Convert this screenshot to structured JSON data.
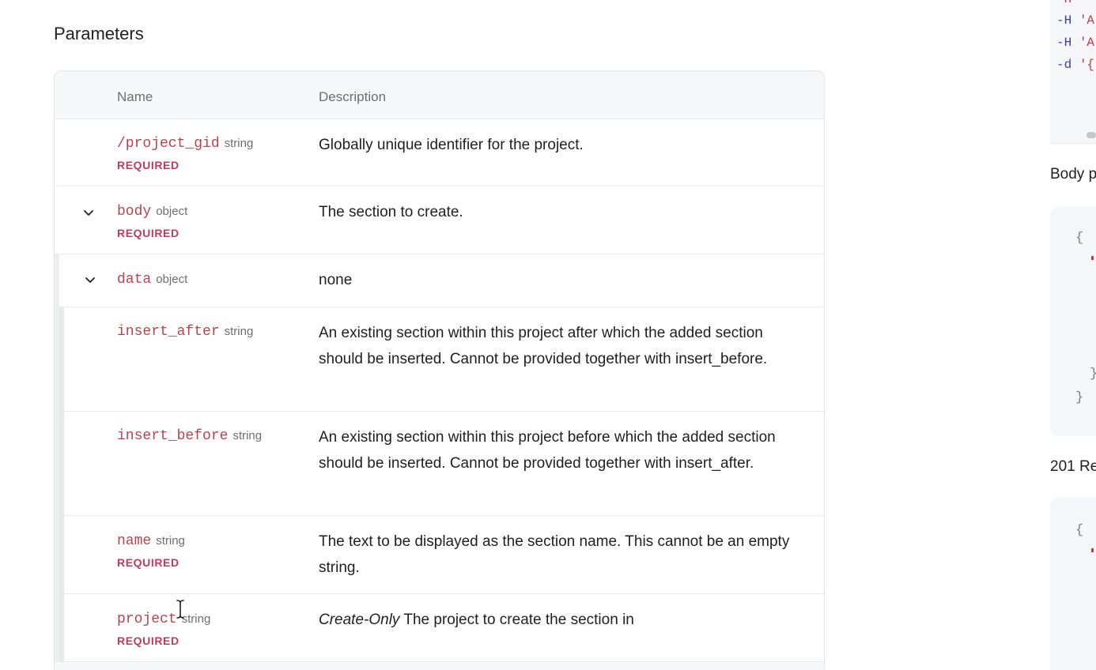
{
  "section_title": "Parameters",
  "table": {
    "headers": {
      "name": "Name",
      "description": "Description"
    },
    "required_label": "REQUIRED",
    "rows": [
      {
        "name": "/project_gid",
        "type": "string",
        "required": true,
        "description": "Globally unique identifier for the project."
      },
      {
        "name": "body",
        "type": "object",
        "required": true,
        "description": "The section to create."
      },
      {
        "name": "data",
        "type": "object",
        "required": false,
        "description": "none"
      },
      {
        "name": "insert_after",
        "type": "string",
        "required": false,
        "description": "An existing section within this project after which the added section should be inserted. Cannot be provided together with insert_before."
      },
      {
        "name": "insert_before",
        "type": "string",
        "required": false,
        "description": "An existing section within this project before which the added section should be inserted. Cannot be provided together with insert_after."
      },
      {
        "name": "name",
        "type": "string",
        "required": true,
        "description": "The text to be displayed as the section name. This cannot be an empty string."
      },
      {
        "name": "project",
        "type": "string",
        "required": true,
        "description_prefix": "Create-Only",
        "description": " The project to create the section in"
      }
    ]
  },
  "right_panel": {
    "curl_lines": [
      {
        "flag": "-H",
        "str": "'A"
      },
      {
        "flag": "-H",
        "str": "'A"
      },
      {
        "flag": "-d",
        "str": "'{"
      }
    ],
    "curl_top_partial": "-H '",
    "body_label": "Body p",
    "response_label": "201 Re",
    "open_brace": "{",
    "close_brace": "}"
  }
}
